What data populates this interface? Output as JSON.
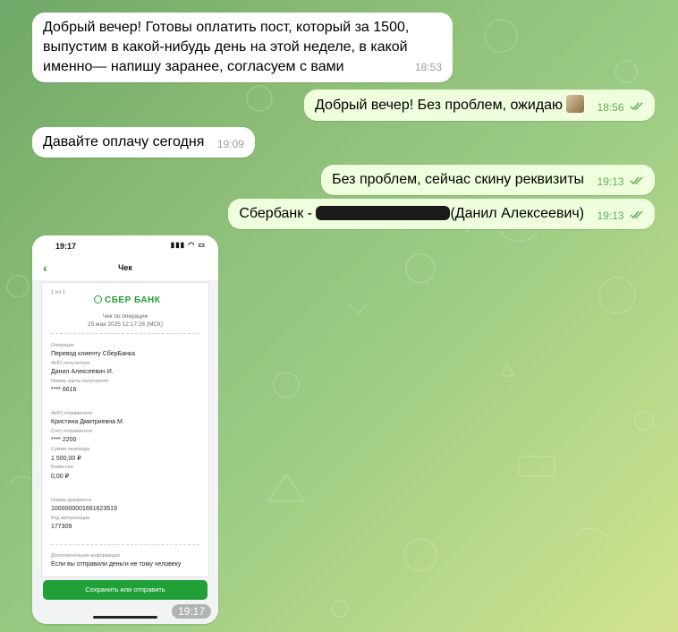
{
  "messages": [
    {
      "text": "Добрый вечер! Готовы оплатить пост, который за 1500, выпустим в какой-нибудь день на этой неделе, в какой именно— напишу заранее, согласуем с вами",
      "time": "18:53"
    },
    {
      "text": "Добрый вечер! Без проблем, ожидаю",
      "time": "18:56"
    },
    {
      "text": "Давайте оплачу сегодня",
      "time": "19:09"
    },
    {
      "text": "Без проблем, сейчас скину реквизиты",
      "time": "19:13"
    },
    {
      "prefix": "Сбербанк - ",
      "suffix": "(Данил Алексеевич)",
      "time": "19:13"
    }
  ],
  "photo": {
    "time": "19:17",
    "status_time": "19:17",
    "nav_title": "Чек",
    "receipt": {
      "pages": "1 из 1",
      "bank": "СБЕР БАНК",
      "subtitle": "Чек по операции",
      "datetime": "25 мая 2025 12:17:28 (МСК)",
      "operation_label": "Операция",
      "operation_value": "Перевод клиенту СберБанка",
      "recipient_label": "ФИО получателя",
      "recipient_value": "Данил Алексеевич И.",
      "recipient_card_label": "Номер карты получателя",
      "recipient_card_value": "**** 6616",
      "sender_label": "ФИО отправителя",
      "sender_value": "Кристина Дмитриевна М.",
      "sender_account_label": "Счёт отправителя",
      "sender_account_value": "**** 2200",
      "amount_label": "Сумма перевода",
      "amount_value": "1 500,00 ₽",
      "fee_label": "Комиссия",
      "fee_value": "0,00 ₽",
      "doc_label": "Номер документа",
      "doc_value": "1000000001661623519",
      "auth_label": "Код авторизации",
      "auth_value": "177309",
      "extra_label": "Дополнительная информация",
      "extra_value": "Если вы отправили деньги не тому человеку"
    },
    "save_button": "Сохранить или отправить"
  },
  "colors": {
    "outgoing_bubble": "#effedd",
    "incoming_bubble": "#ffffff",
    "sber_green": "#21a038"
  }
}
